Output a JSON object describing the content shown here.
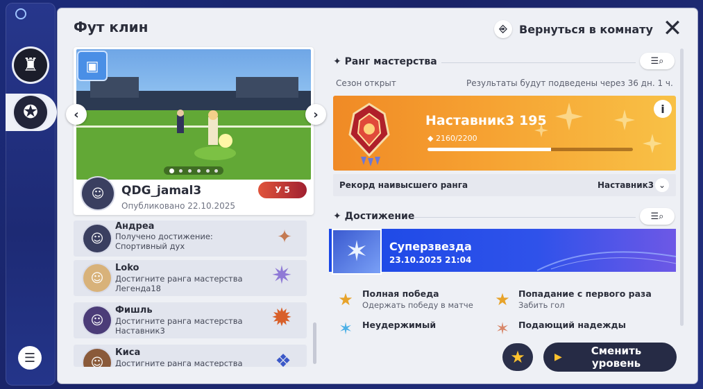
{
  "title": "Фут клин",
  "return_label": "Вернуться в комнату",
  "sidebar": {
    "items": [
      {
        "icon": "chess-rook-icon",
        "glyph": "♜"
      },
      {
        "icon": "medal-icon",
        "glyph": "✪"
      }
    ],
    "menu_glyph": "☰"
  },
  "post": {
    "username": "QDG_jamal3",
    "published": "Опубликовано 22.10.2025",
    "level_prefix": "У",
    "level": "5",
    "badge_glyph": "▣",
    "avatar_glyph": "☺",
    "image_count": 6,
    "image_index": 0
  },
  "feed": [
    {
      "name": "Андреа",
      "text": "Получено достижение: Спортивный дух",
      "icon": "achievement-star-icon",
      "glyph": "✦",
      "color": "#c47a52"
    },
    {
      "name": "Loko",
      "text": "Достигните ранга мастерства Легенда18",
      "icon": "legend-rank-icon",
      "glyph": "✷",
      "color": "#8f7ad6"
    },
    {
      "name": "Фишль",
      "text": "Достигните ранга мастерства Наставник3",
      "icon": "mentor-rank-icon",
      "glyph": "✹",
      "color": "#d8602a"
    },
    {
      "name": "Киса",
      "text": "Достигните ранга мастерства",
      "icon": "rank-icon",
      "glyph": "❖",
      "color": "#3b58c8"
    }
  ],
  "mastery": {
    "section_title": "Ранг мастерства",
    "season_status": "Сезон открыт",
    "results_text": "Результаты будут подведены через 36 дн. 1 ч.",
    "rank_name": "Наставник3",
    "rank_points": "195",
    "progress_text": "2160/2200",
    "progress": 0.6,
    "record_label": "Рекорд наивысшего ранга",
    "record_value": "Наставник3",
    "info_glyph": "i",
    "card_color": "#f6a232"
  },
  "achievements": {
    "section_title": "Достижение",
    "featured": {
      "name": "Суперзвезда",
      "date": "23.10.2025 21:04",
      "glyph": "✶"
    },
    "items": [
      {
        "name": "Полная победа",
        "desc": "Одержать победу в матче",
        "glyph": "★",
        "color": "#e7a32a"
      },
      {
        "name": "Попадание с первого раза",
        "desc": "Забить гол",
        "glyph": "★",
        "color": "#e7a32a"
      },
      {
        "name": "Неудержимый",
        "desc": "",
        "glyph": "✶",
        "color": "#4cb0e6"
      },
      {
        "name": "Подающий надежды",
        "desc": "",
        "glyph": "✶",
        "color": "#d8876a"
      }
    ]
  },
  "actions": {
    "star_glyph": "★",
    "change_level_line1": "Сменить",
    "change_level_line2": "уровень"
  }
}
